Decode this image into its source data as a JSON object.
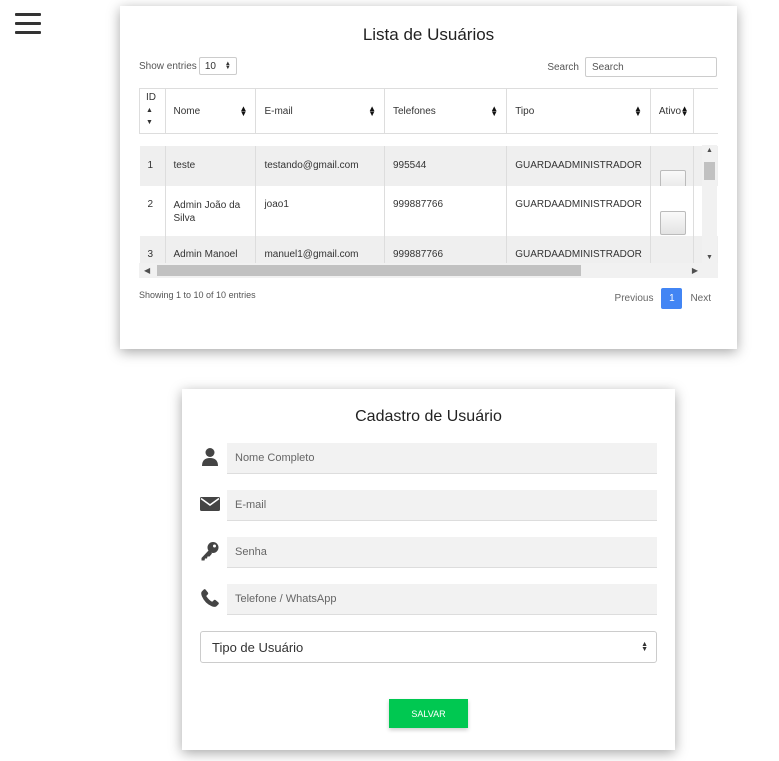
{
  "menu": {
    "icon": "hamburger-menu-icon"
  },
  "user_list": {
    "title": "Lista de Usuários",
    "show_entries_label": "Show entries",
    "entries_value": "10",
    "search_label": "Search",
    "search_placeholder": "Search",
    "columns": [
      {
        "id_line1": "ID",
        "label": ""
      },
      {
        "label": "Nome"
      },
      {
        "label": "E-mail"
      },
      {
        "label": "Telefones"
      },
      {
        "label": "Tipo"
      },
      {
        "label": "Ativo"
      }
    ],
    "rows": [
      {
        "id": "1",
        "nome": "teste",
        "email": "testando@gmail.com",
        "telefone": "995544",
        "tipo": "GUARDAADMINISTRADOR"
      },
      {
        "id": "2",
        "nome_line1": "Admin João da",
        "nome_line2": "Silva",
        "email": "joao1",
        "telefone": "999887766",
        "tipo": "GUARDAADMINISTRADOR"
      },
      {
        "id": "3",
        "nome": "Admin Manoel",
        "email": "manuel1@gmail.com",
        "telefone": "999887766",
        "tipo": "GUARDAADMINISTRADOR"
      }
    ],
    "info": "Showing 1 to 10 of 10 entries",
    "previous": "Previous",
    "current_page": "1",
    "next": "Next"
  },
  "register_form": {
    "title": "Cadastro de Usuário",
    "fields": [
      {
        "icon": "user-icon",
        "placeholder": "Nome Completo"
      },
      {
        "icon": "envelope-icon",
        "placeholder": "E-mail"
      },
      {
        "icon": "key-icon",
        "placeholder": "Senha"
      },
      {
        "icon": "phone-icon",
        "placeholder": "Telefone / WhatsApp"
      }
    ],
    "type_select": "Tipo de Usuário",
    "save_label": "SALVAR"
  },
  "colors": {
    "accent_blue": "#4285f4",
    "save_green": "#00c851"
  }
}
